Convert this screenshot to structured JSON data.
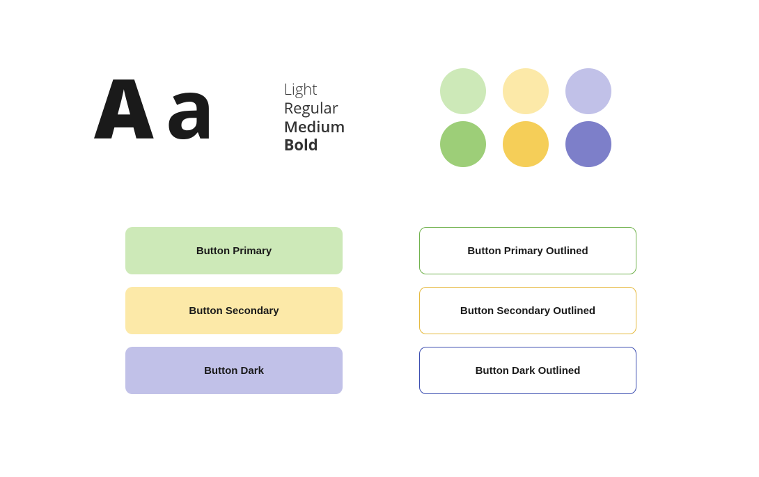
{
  "typography": {
    "sample_upper": "A",
    "sample_lower": "a",
    "weights": {
      "light": "Light",
      "regular": "Regular",
      "medium": "Medium",
      "bold": "Bold"
    }
  },
  "palette": {
    "primary_light": "#cde9b8",
    "primary": "#9dce78",
    "secondary_light": "#fce9a8",
    "secondary": "#f5ce58",
    "dark_light": "#c1c1e8",
    "dark": "#7d7fc9",
    "primary_border": "#6fb14c",
    "secondary_border": "#e5b93e",
    "dark_border": "#3b4db0"
  },
  "buttons": {
    "primary": "Button Primary",
    "secondary": "Button Secondary",
    "dark": "Button Dark",
    "primary_outlined": "Button Primary Outlined",
    "secondary_outlined": "Button Secondary Outlined",
    "dark_outlined": "Button Dark Outlined"
  }
}
